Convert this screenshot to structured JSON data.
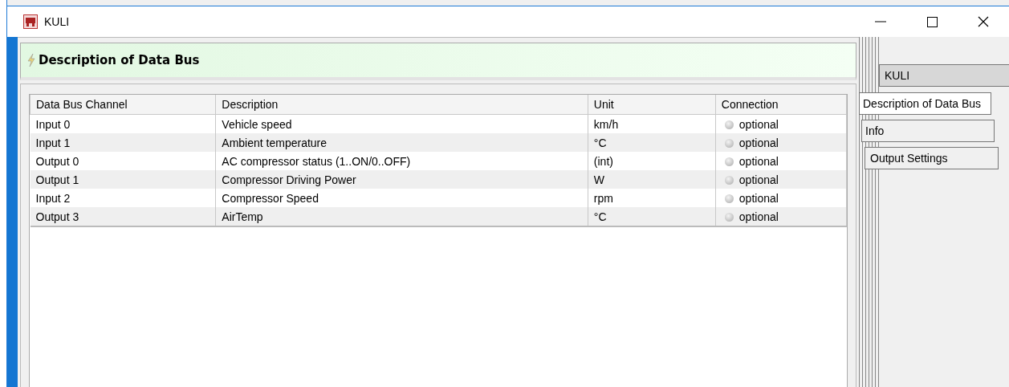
{
  "window": {
    "title": "KULI"
  },
  "panel": {
    "title": "Description of Data Bus"
  },
  "table": {
    "columns": [
      "Data Bus Channel",
      "Description",
      "Unit",
      "Connection"
    ],
    "rows": [
      {
        "channel": "Input 0",
        "description": "Vehicle speed",
        "unit": "km/h",
        "connection": "optional"
      },
      {
        "channel": "Input 1",
        "description": "Ambient temperature",
        "unit": "°C",
        "connection": "optional"
      },
      {
        "channel": "Output 0",
        "description": "AC compressor status (1..ON/0..OFF)",
        "unit": "(int)",
        "connection": "optional"
      },
      {
        "channel": "Output 1",
        "description": "Compressor Driving Power",
        "unit": "W",
        "connection": "optional"
      },
      {
        "channel": "Input 2",
        "description": "Compressor Speed",
        "unit": "rpm",
        "connection": "optional"
      },
      {
        "channel": "Output 3",
        "description": "AirTemp",
        "unit": "°C",
        "connection": "optional"
      }
    ]
  },
  "tabs": [
    {
      "label": "KULI",
      "selected": false
    },
    {
      "label": "Description of Data Bus",
      "selected": true
    },
    {
      "label": "Info",
      "selected": false
    },
    {
      "label": "Output Settings",
      "selected": false
    }
  ]
}
